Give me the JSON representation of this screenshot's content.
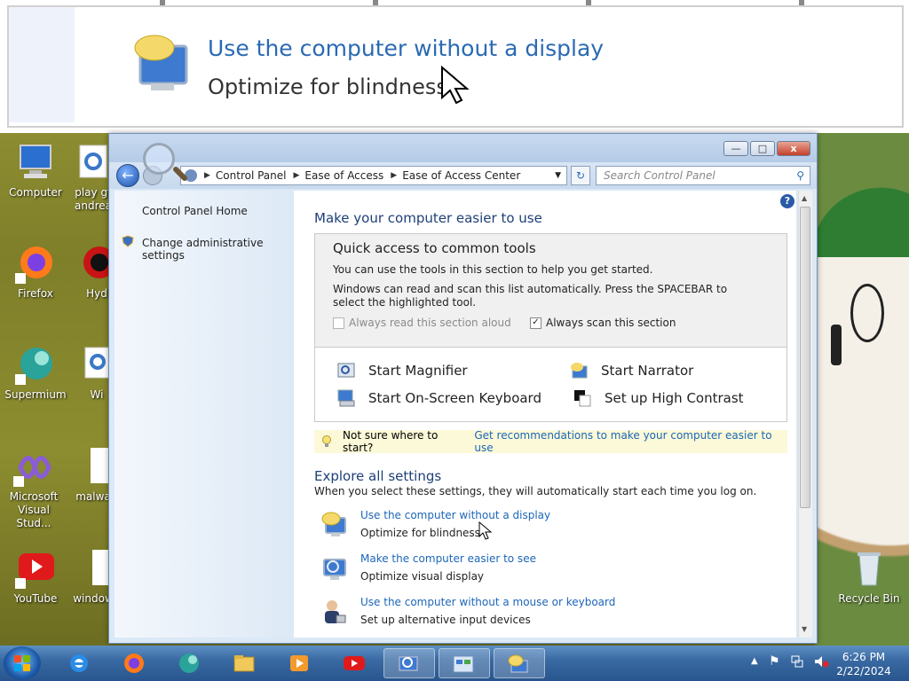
{
  "magnifier": {
    "link": "Use the computer without a display",
    "sub": "Optimize for blindness"
  },
  "desktop_icons": [
    {
      "label": "Computer"
    },
    {
      "label": "play gt andrea"
    },
    {
      "label": "Firefox"
    },
    {
      "label": "Hyd"
    },
    {
      "label": "Supermium"
    },
    {
      "label": "Wi"
    },
    {
      "label": "Microsoft Visual Stud..."
    },
    {
      "label": "malwa"
    },
    {
      "label": "YouTube"
    },
    {
      "label": "window"
    },
    {
      "label": "Recycle Bin"
    }
  ],
  "window": {
    "buttons": {
      "minimize": "—",
      "maximize": "□",
      "close": "x"
    },
    "breadcrumb": [
      "Control Panel",
      "Ease of Access",
      "Ease of Access Center"
    ],
    "search_placeholder": "Search Control Panel",
    "left_pane": {
      "home": "Control Panel Home",
      "admin": "Change administrative settings"
    },
    "heading": "Make your computer easier to use",
    "quick_access": {
      "title": "Quick access to common tools",
      "line1": "You can use the tools in this section to help you get started.",
      "line2": "Windows can read and scan this list automatically.  Press the SPACEBAR to select the highlighted tool.",
      "read_aloud": {
        "label": "Always read this section aloud",
        "checked": false
      },
      "scan": {
        "label": "Always scan this section",
        "checked": true
      }
    },
    "tools": {
      "magnifier": "Start Magnifier",
      "narrator": "Start Narrator",
      "keyboard": "Start On-Screen Keyboard",
      "contrast": "Set up High Contrast"
    },
    "tip": {
      "text": "Not sure where to start?",
      "link": "Get recommendations to make your computer easier to use"
    },
    "explore": {
      "title": "Explore all settings",
      "subtitle": "When you select these settings, they will automatically start each time you log on.",
      "items": [
        {
          "link": "Use the computer without a display",
          "desc": "Optimize for blindness"
        },
        {
          "link": "Make the computer easier to see",
          "desc": "Optimize visual display"
        },
        {
          "link": "Use the computer without a mouse or keyboard",
          "desc": "Set up alternative input devices"
        }
      ]
    }
  },
  "taskbar": {
    "time": "6:26 PM",
    "date": "2/22/2024"
  }
}
